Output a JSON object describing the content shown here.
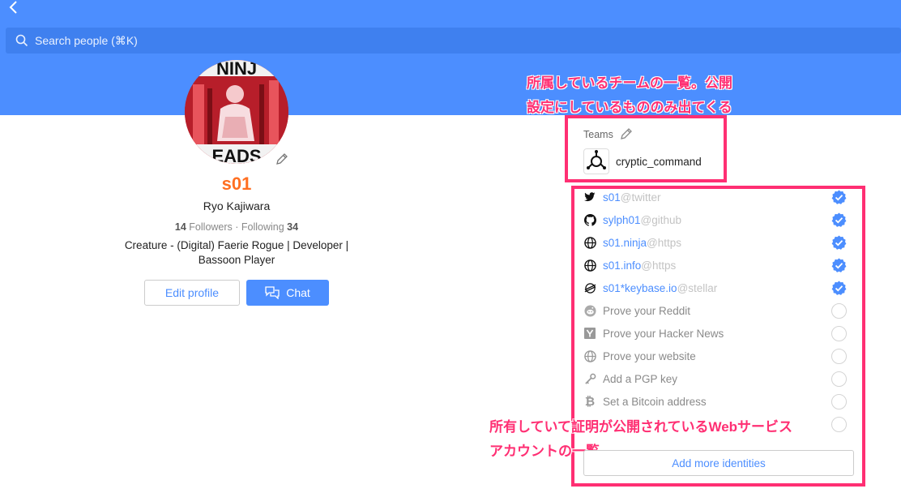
{
  "search": {
    "placeholder": "Search people (⌘K)"
  },
  "profile": {
    "username": "s01",
    "fullname": "Ryo Kajiwara",
    "followers_count": "14",
    "followers_label": " Followers · Following ",
    "following_count": "34",
    "bio_line1": "Creature - (Digital) Faerie Rogue | Developer |",
    "bio_line2": "Bassoon Player",
    "avatar_text_top": "NINJ",
    "avatar_text_bottom": "EADS"
  },
  "actions": {
    "edit_profile": "Edit profile",
    "chat": "Chat"
  },
  "annotations": {
    "teams_line1": "所属しているチームの一覧。公開",
    "teams_line2": "設定にしているもののみ出てくる",
    "ids_line1": "所有していて証明が公開されているWebサービス",
    "ids_line2": "アカウントの一覧"
  },
  "teams": {
    "label": "Teams",
    "items": [
      {
        "name": "cryptic_command"
      }
    ]
  },
  "identities": [
    {
      "icon": "twitter-icon",
      "handle": "s01",
      "service": "@twitter",
      "verified": true
    },
    {
      "icon": "github-icon",
      "handle": "sylph01",
      "service": "@github",
      "verified": true
    },
    {
      "icon": "globe-icon",
      "handle": "s01.ninja",
      "service": "@https",
      "verified": true
    },
    {
      "icon": "globe-icon",
      "handle": "s01.info",
      "service": "@https",
      "verified": true
    },
    {
      "icon": "stellar-icon",
      "handle": "s01*keybase.io",
      "service": "@stellar",
      "verified": true
    }
  ],
  "proofs": [
    {
      "icon": "reddit-icon",
      "label": "Prove your Reddit"
    },
    {
      "icon": "hacker-news-icon",
      "label": "Prove your Hacker News"
    },
    {
      "icon": "globe-icon",
      "label": "Prove your website"
    },
    {
      "icon": "key-icon",
      "label": "Add a PGP key"
    },
    {
      "icon": "bitcoin-icon",
      "label": "Set a Bitcoin address"
    }
  ],
  "add_identities": "Add more identities",
  "colors": {
    "header": "#4c8eff",
    "accent": "#4c8eff",
    "username": "#ff6f21",
    "annotation": "#ff2f73"
  }
}
